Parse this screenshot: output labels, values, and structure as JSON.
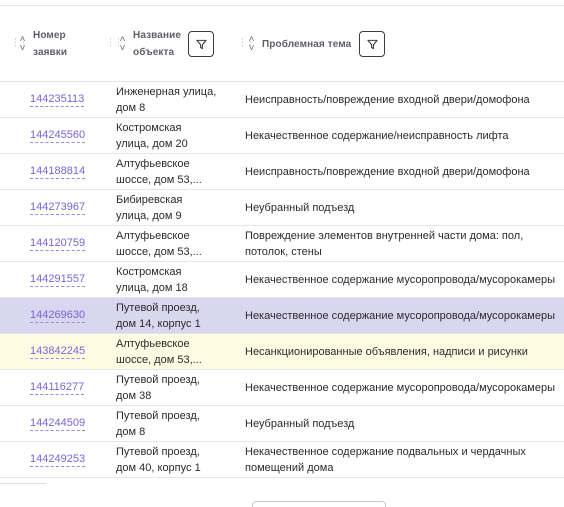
{
  "header": {
    "col_id": {
      "line1": "Номер",
      "line2": "заявки"
    },
    "col_object": {
      "line1": "Название",
      "line2": "объекта"
    },
    "col_topic": {
      "label": "Проблемная тема"
    }
  },
  "rows": [
    {
      "id": "144235113",
      "object_line1": "Инженерная улица,",
      "object_line2": "дом 8",
      "topic_line1": "Неисправность/повреждение входной двери/домофона",
      "topic_line2": "",
      "state": "normal"
    },
    {
      "id": "144245560",
      "object_line1": "Костромская",
      "object_line2": "улица, дом 20",
      "topic_line1": "Некачественное содержание/неисправность лифта",
      "topic_line2": "",
      "state": "normal"
    },
    {
      "id": "144188814",
      "object_line1": "Алтуфьевское",
      "object_line2": "шоссе, дом 53,...",
      "topic_line1": "Неисправность/повреждение входной двери/домофона",
      "topic_line2": "",
      "state": "normal"
    },
    {
      "id": "144273967",
      "object_line1": "Бибиревская",
      "object_line2": "улица, дом 9",
      "topic_line1": "Неубранный подъезд",
      "topic_line2": "",
      "state": "normal"
    },
    {
      "id": "144120759",
      "object_line1": "Алтуфьевское",
      "object_line2": "шоссе, дом 53,...",
      "topic_line1": "Повреждение элементов внутренней части дома: пол,",
      "topic_line2": "потолок, стены",
      "state": "normal"
    },
    {
      "id": "144291557",
      "object_line1": "Костромская",
      "object_line2": "улица, дом 18",
      "topic_line1": "Некачественное содержание мусоропровода/мусорокамеры",
      "topic_line2": "",
      "state": "normal"
    },
    {
      "id": "144269630",
      "object_line1": "Путевой проезд,",
      "object_line2": "дом 14, корпус 1",
      "topic_line1": "Некачественное содержание мусоропровода/мусорокамеры",
      "topic_line2": "",
      "state": "selected"
    },
    {
      "id": "143842245",
      "object_line1": "Алтуфьевское",
      "object_line2": "шоссе, дом 53,...",
      "topic_line1": "Несанкционированные объявления, надписи и рисунки",
      "topic_line2": "",
      "state": "hover"
    },
    {
      "id": "144116277",
      "object_line1": "Путевой проезд,",
      "object_line2": "дом 38",
      "topic_line1": "Некачественное содержание мусоропровода/мусорокамеры",
      "topic_line2": "",
      "state": "normal"
    },
    {
      "id": "144244509",
      "object_line1": "Путевой проезд,",
      "object_line2": "дом 8",
      "topic_line1": "Неубранный подъезд",
      "topic_line2": "",
      "state": "normal"
    },
    {
      "id": "144249253",
      "object_line1": "Путевой проезд,",
      "object_line2": "дом 40, корпус 1",
      "topic_line1": "Некачественное содержание подвальных и чердачных",
      "topic_line2": "помещений дома",
      "state": "normal"
    }
  ],
  "colors": {
    "link": "#7b63d6",
    "selected_row": "#d9d6ef",
    "hover_row": "#fdfce3"
  },
  "icons": {
    "filter": "filter-icon",
    "sort": "sort-arrows-icon",
    "drag": "drag-grip-icon"
  }
}
